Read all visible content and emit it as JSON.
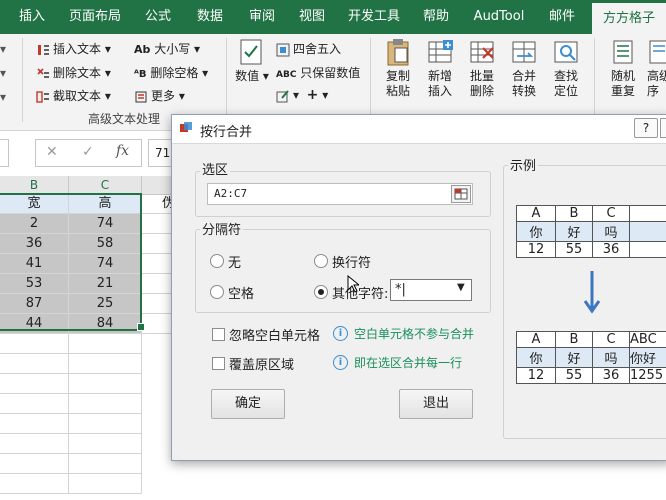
{
  "ribbon": {
    "tabs": [
      "插入",
      "页面布局",
      "公式",
      "数据",
      "审阅",
      "视图",
      "开发工具",
      "帮助",
      "AudTool",
      "邮件",
      "方方格子"
    ],
    "active_tab": "方方格子",
    "text_group": {
      "insert_text": "插入文本",
      "delete_text": "删除文本",
      "extract_text": "截取文本",
      "case": "大小写",
      "delete_space": "删除空格",
      "more": "更多",
      "group_label": "高级文本处理"
    },
    "number_group": {
      "value_btn": "数值",
      "round": "四舍五入",
      "keep_values": "只保留数值",
      "group_label_partial": "数值录入"
    },
    "edit_group": {
      "copy_paste": "复制粘贴",
      "insert": "新增插入",
      "batch_delete": "批量删除",
      "merge_convert": "合并转换",
      "find_locate": "查找定位",
      "group_label_partial": "编辑"
    },
    "random_group": {
      "random_repeat": "随机重复",
      "advanced_seq": "高级序"
    }
  },
  "formula_bar": {
    "cancel": "✕",
    "confirm": "✓",
    "fx": "fx",
    "value": "71"
  },
  "sheet": {
    "columns": [
      "B",
      "C"
    ],
    "extra_col_header_partial": "伪",
    "header_row": [
      "宽",
      "高"
    ],
    "rows": [
      [
        "2",
        "74"
      ],
      [
        "36",
        "58"
      ],
      [
        "41",
        "74"
      ],
      [
        "53",
        "21"
      ],
      [
        "87",
        "25"
      ],
      [
        "44",
        "84"
      ]
    ]
  },
  "dialog": {
    "title": "按行合并",
    "selection_label": "选区",
    "selection_value": "A2:C7",
    "separator_label": "分隔符",
    "opt_none": "无",
    "opt_newline": "换行符",
    "opt_space": "空格",
    "opt_other": "其他字符:",
    "other_value": "*|",
    "selected_option": "other",
    "ignore_blank": "忽略空白单元格",
    "ignore_blank_hint": "空白单元格不参与合并",
    "overwrite": "覆盖原区域",
    "overwrite_hint": "即在选区合并每一行",
    "ok": "确定",
    "exit": "退出",
    "example_label": "示例",
    "example_before": {
      "header": [
        "A",
        "B",
        "C"
      ],
      "rows": [
        [
          "你",
          "好",
          "吗"
        ],
        [
          "12",
          "55",
          "36"
        ]
      ]
    },
    "example_after": {
      "header": [
        "A",
        "B",
        "C",
        "ABC"
      ],
      "rows": [
        [
          "你",
          "好",
          "吗",
          "你好"
        ],
        [
          "12",
          "55",
          "36",
          "1255"
        ]
      ]
    },
    "help": "?"
  }
}
